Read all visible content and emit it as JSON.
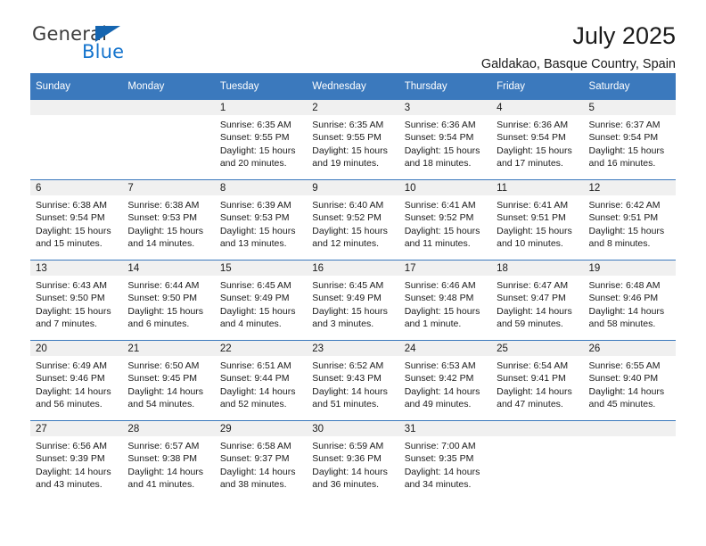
{
  "brand": {
    "name_part1": "General",
    "name_part2": "Blue",
    "triangle_color": "#1565b0",
    "blue_color": "#1574cd"
  },
  "header": {
    "title": "July 2025",
    "subtitle": "Galdakao, Basque Country, Spain"
  },
  "theme": {
    "header_bg": "#3b79bd",
    "header_text": "#ffffff",
    "daynum_strip_bg": "#f0f0f0",
    "row_border": "#3b79bd"
  },
  "columns": [
    "Sunday",
    "Monday",
    "Tuesday",
    "Wednesday",
    "Thursday",
    "Friday",
    "Saturday"
  ],
  "labels": {
    "sunrise_prefix": "Sunrise: ",
    "sunset_prefix": "Sunset: ",
    "daylight_prefix": "Daylight: "
  },
  "weeks": [
    [
      {
        "day": "",
        "empty": true
      },
      {
        "day": "",
        "empty": true
      },
      {
        "day": "1",
        "sunrise": "Sunrise: 6:35 AM",
        "sunset": "Sunset: 9:55 PM",
        "daylight": "Daylight: 15 hours and 20 minutes."
      },
      {
        "day": "2",
        "sunrise": "Sunrise: 6:35 AM",
        "sunset": "Sunset: 9:55 PM",
        "daylight": "Daylight: 15 hours and 19 minutes."
      },
      {
        "day": "3",
        "sunrise": "Sunrise: 6:36 AM",
        "sunset": "Sunset: 9:54 PM",
        "daylight": "Daylight: 15 hours and 18 minutes."
      },
      {
        "day": "4",
        "sunrise": "Sunrise: 6:36 AM",
        "sunset": "Sunset: 9:54 PM",
        "daylight": "Daylight: 15 hours and 17 minutes."
      },
      {
        "day": "5",
        "sunrise": "Sunrise: 6:37 AM",
        "sunset": "Sunset: 9:54 PM",
        "daylight": "Daylight: 15 hours and 16 minutes."
      }
    ],
    [
      {
        "day": "6",
        "sunrise": "Sunrise: 6:38 AM",
        "sunset": "Sunset: 9:54 PM",
        "daylight": "Daylight: 15 hours and 15 minutes."
      },
      {
        "day": "7",
        "sunrise": "Sunrise: 6:38 AM",
        "sunset": "Sunset: 9:53 PM",
        "daylight": "Daylight: 15 hours and 14 minutes."
      },
      {
        "day": "8",
        "sunrise": "Sunrise: 6:39 AM",
        "sunset": "Sunset: 9:53 PM",
        "daylight": "Daylight: 15 hours and 13 minutes."
      },
      {
        "day": "9",
        "sunrise": "Sunrise: 6:40 AM",
        "sunset": "Sunset: 9:52 PM",
        "daylight": "Daylight: 15 hours and 12 minutes."
      },
      {
        "day": "10",
        "sunrise": "Sunrise: 6:41 AM",
        "sunset": "Sunset: 9:52 PM",
        "daylight": "Daylight: 15 hours and 11 minutes."
      },
      {
        "day": "11",
        "sunrise": "Sunrise: 6:41 AM",
        "sunset": "Sunset: 9:51 PM",
        "daylight": "Daylight: 15 hours and 10 minutes."
      },
      {
        "day": "12",
        "sunrise": "Sunrise: 6:42 AM",
        "sunset": "Sunset: 9:51 PM",
        "daylight": "Daylight: 15 hours and 8 minutes."
      }
    ],
    [
      {
        "day": "13",
        "sunrise": "Sunrise: 6:43 AM",
        "sunset": "Sunset: 9:50 PM",
        "daylight": "Daylight: 15 hours and 7 minutes."
      },
      {
        "day": "14",
        "sunrise": "Sunrise: 6:44 AM",
        "sunset": "Sunset: 9:50 PM",
        "daylight": "Daylight: 15 hours and 6 minutes."
      },
      {
        "day": "15",
        "sunrise": "Sunrise: 6:45 AM",
        "sunset": "Sunset: 9:49 PM",
        "daylight": "Daylight: 15 hours and 4 minutes."
      },
      {
        "day": "16",
        "sunrise": "Sunrise: 6:45 AM",
        "sunset": "Sunset: 9:49 PM",
        "daylight": "Daylight: 15 hours and 3 minutes."
      },
      {
        "day": "17",
        "sunrise": "Sunrise: 6:46 AM",
        "sunset": "Sunset: 9:48 PM",
        "daylight": "Daylight: 15 hours and 1 minute."
      },
      {
        "day": "18",
        "sunrise": "Sunrise: 6:47 AM",
        "sunset": "Sunset: 9:47 PM",
        "daylight": "Daylight: 14 hours and 59 minutes."
      },
      {
        "day": "19",
        "sunrise": "Sunrise: 6:48 AM",
        "sunset": "Sunset: 9:46 PM",
        "daylight": "Daylight: 14 hours and 58 minutes."
      }
    ],
    [
      {
        "day": "20",
        "sunrise": "Sunrise: 6:49 AM",
        "sunset": "Sunset: 9:46 PM",
        "daylight": "Daylight: 14 hours and 56 minutes."
      },
      {
        "day": "21",
        "sunrise": "Sunrise: 6:50 AM",
        "sunset": "Sunset: 9:45 PM",
        "daylight": "Daylight: 14 hours and 54 minutes."
      },
      {
        "day": "22",
        "sunrise": "Sunrise: 6:51 AM",
        "sunset": "Sunset: 9:44 PM",
        "daylight": "Daylight: 14 hours and 52 minutes."
      },
      {
        "day": "23",
        "sunrise": "Sunrise: 6:52 AM",
        "sunset": "Sunset: 9:43 PM",
        "daylight": "Daylight: 14 hours and 51 minutes."
      },
      {
        "day": "24",
        "sunrise": "Sunrise: 6:53 AM",
        "sunset": "Sunset: 9:42 PM",
        "daylight": "Daylight: 14 hours and 49 minutes."
      },
      {
        "day": "25",
        "sunrise": "Sunrise: 6:54 AM",
        "sunset": "Sunset: 9:41 PM",
        "daylight": "Daylight: 14 hours and 47 minutes."
      },
      {
        "day": "26",
        "sunrise": "Sunrise: 6:55 AM",
        "sunset": "Sunset: 9:40 PM",
        "daylight": "Daylight: 14 hours and 45 minutes."
      }
    ],
    [
      {
        "day": "27",
        "sunrise": "Sunrise: 6:56 AM",
        "sunset": "Sunset: 9:39 PM",
        "daylight": "Daylight: 14 hours and 43 minutes."
      },
      {
        "day": "28",
        "sunrise": "Sunrise: 6:57 AM",
        "sunset": "Sunset: 9:38 PM",
        "daylight": "Daylight: 14 hours and 41 minutes."
      },
      {
        "day": "29",
        "sunrise": "Sunrise: 6:58 AM",
        "sunset": "Sunset: 9:37 PM",
        "daylight": "Daylight: 14 hours and 38 minutes."
      },
      {
        "day": "30",
        "sunrise": "Sunrise: 6:59 AM",
        "sunset": "Sunset: 9:36 PM",
        "daylight": "Daylight: 14 hours and 36 minutes."
      },
      {
        "day": "31",
        "sunrise": "Sunrise: 7:00 AM",
        "sunset": "Sunset: 9:35 PM",
        "daylight": "Daylight: 14 hours and 34 minutes."
      },
      {
        "day": "",
        "empty": true
      },
      {
        "day": "",
        "empty": true
      }
    ]
  ]
}
